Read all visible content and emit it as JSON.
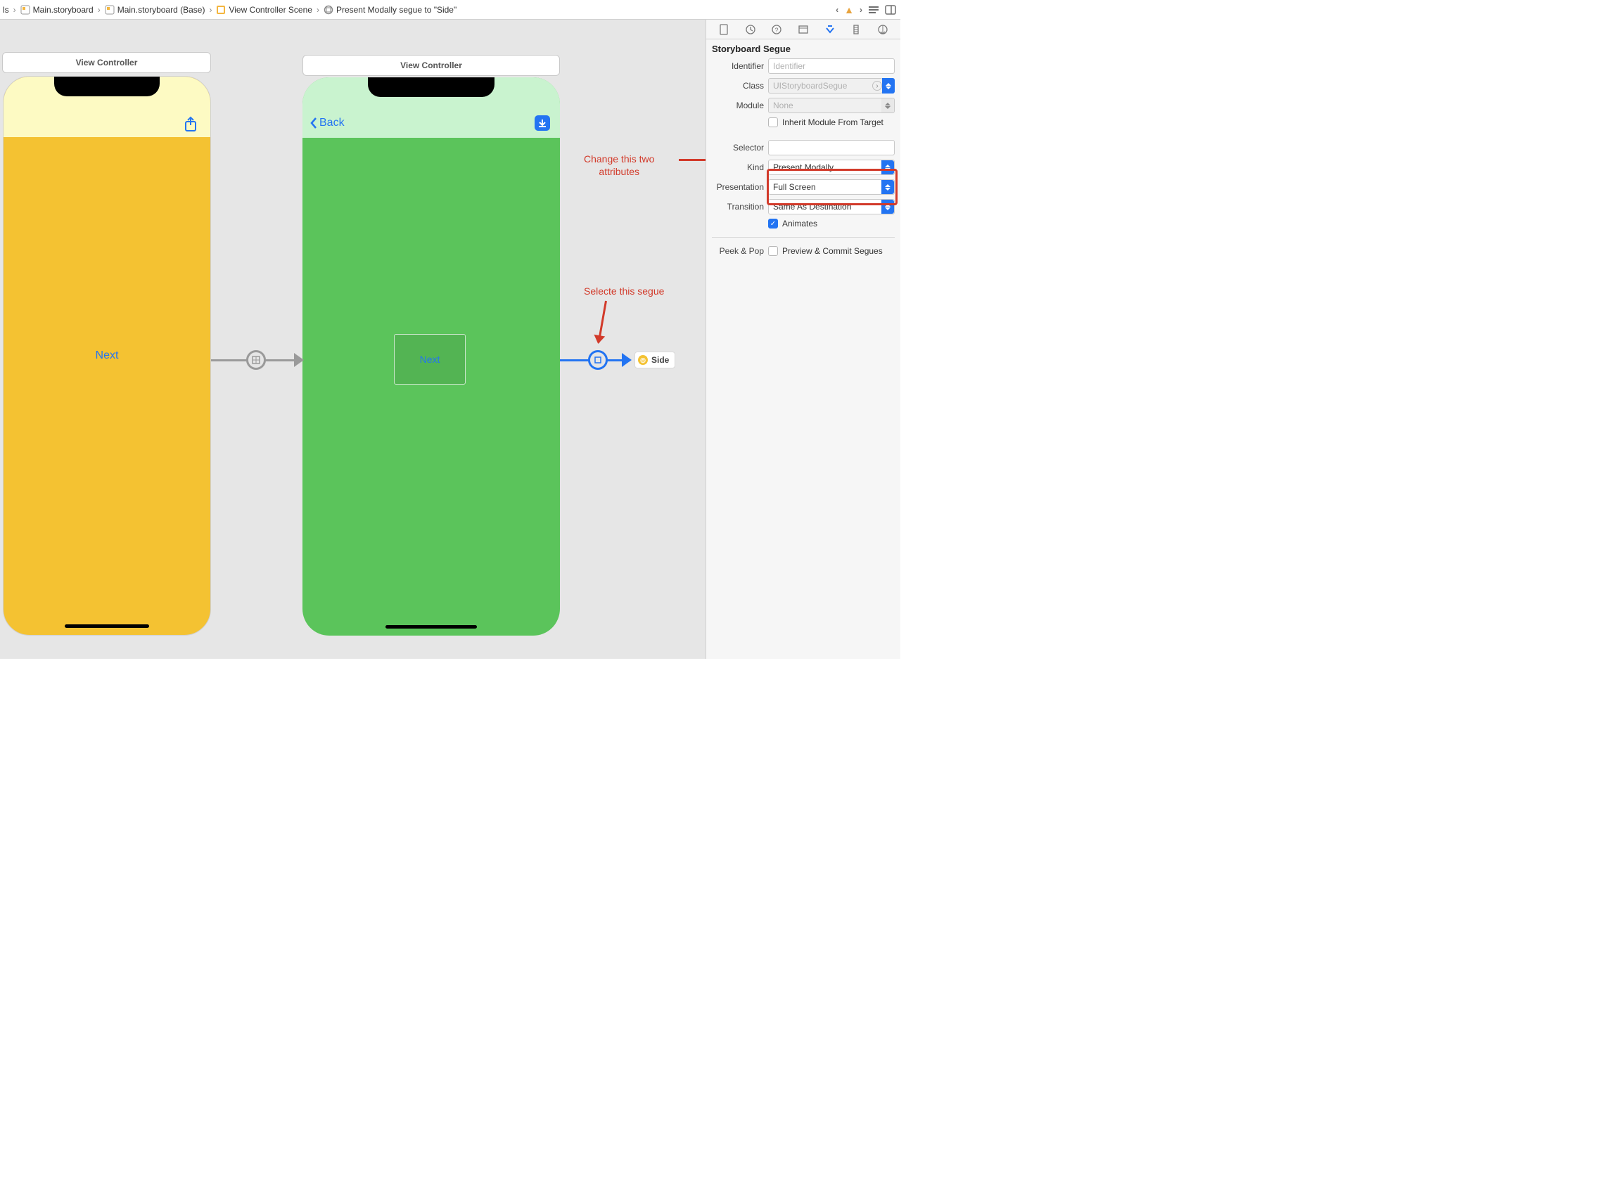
{
  "breadcrumb": [
    {
      "label": "ls",
      "iconColor": "#f4b63f",
      "iconKind": "folder"
    },
    {
      "label": "Main.storyboard",
      "iconColor": "#f4b63f",
      "iconKind": "doc"
    },
    {
      "label": "Main.storyboard (Base)",
      "iconColor": "#f4b63f",
      "iconKind": "doc"
    },
    {
      "label": "View Controller Scene",
      "iconColor": "#f4b63f",
      "iconKind": "scene"
    },
    {
      "label": "Present Modally segue to \"Side\"",
      "iconColor": "#888888",
      "iconKind": "segue"
    }
  ],
  "canvas": {
    "sceneA_title": "View Controller",
    "sceneB_title": "View Controller",
    "sceneA_button": "Next",
    "sceneB_back": "Back",
    "sceneB_container_button": "Next",
    "side_chip": "Side"
  },
  "annotations": {
    "attrs": "Change this two\nattributes",
    "segue": "Selecte this segue"
  },
  "inspector": {
    "header": "Storyboard Segue",
    "identifier_label": "Identifier",
    "identifier_placeholder": "Identifier",
    "identifier_value": "",
    "class_label": "Class",
    "class_value": "UIStoryboardSegue",
    "module_label": "Module",
    "module_value": "None",
    "inherit_label": "Inherit Module From Target",
    "inherit_checked": false,
    "selector_label": "Selector",
    "selector_value": "",
    "kind_label": "Kind",
    "kind_value": "Present Modally",
    "presentation_label": "Presentation",
    "presentation_value": "Full Screen",
    "transition_label": "Transition",
    "transition_value": "Same As Destination",
    "animates_label": "Animates",
    "animates_checked": true,
    "peekpop_label": "Peek & Pop",
    "peekpop_text": "Preview & Commit Segues",
    "peekpop_checked": false
  }
}
